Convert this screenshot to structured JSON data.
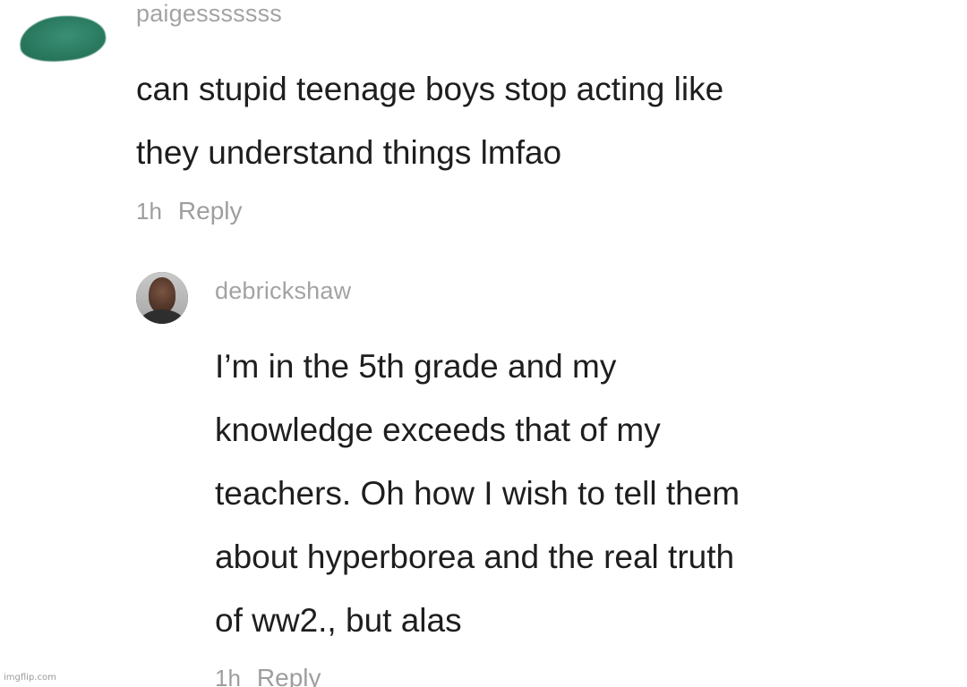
{
  "comments": [
    {
      "username": "paigesssssss",
      "lines": [
        "can stupid teenage boys stop acting like",
        "they understand things lmfao"
      ],
      "time": "1h",
      "reply_label": "Reply",
      "avatar_icon": "green-blob-avatar"
    },
    {
      "username": "debrickshaw",
      "lines": [
        "I’m in the 5th grade and my",
        "knowledge exceeds that of my",
        "teachers. Oh how I wish to tell them",
        "about hyperborea and the real truth",
        "of ww2., but alas"
      ],
      "time": "1h",
      "reply_label": "Reply",
      "avatar_icon": "profile-photo-avatar"
    }
  ],
  "watermark": "imgflip.com"
}
